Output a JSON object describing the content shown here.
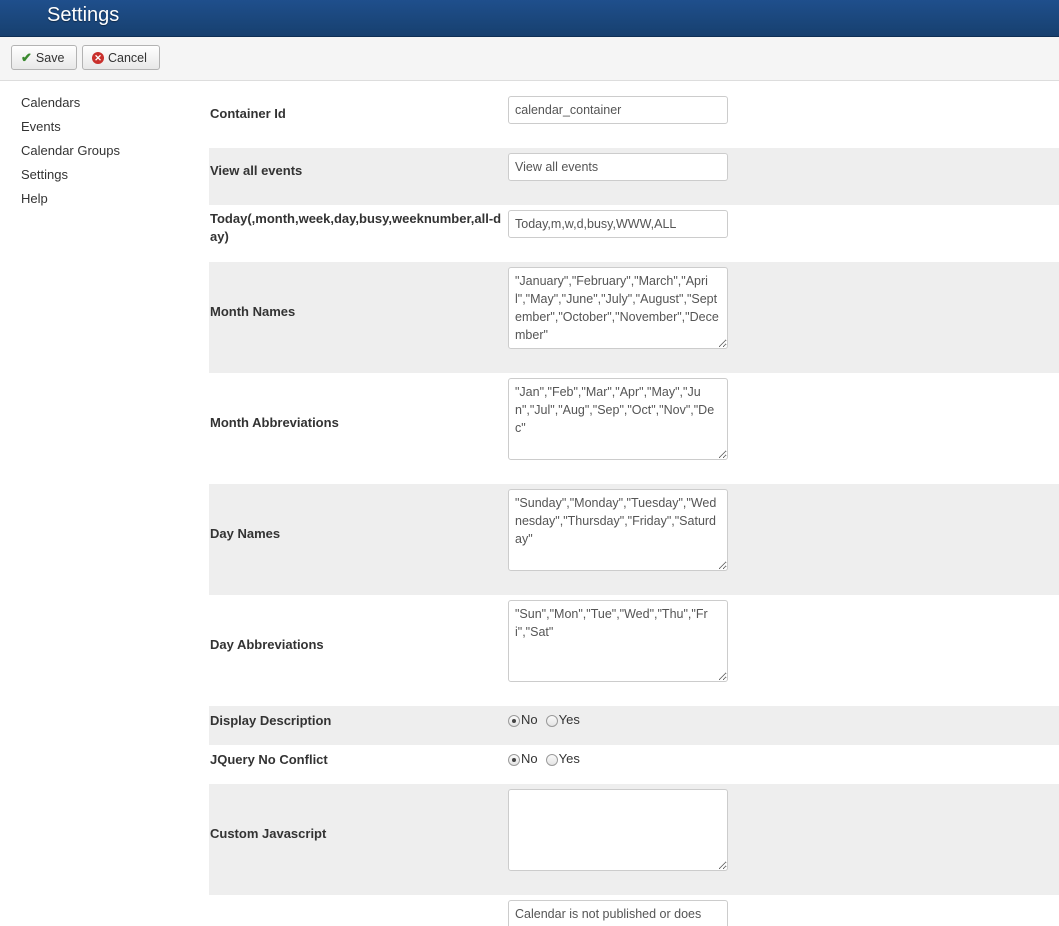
{
  "header": {
    "title": "Settings"
  },
  "toolbar": {
    "save_label": "Save",
    "cancel_label": "Cancel"
  },
  "sidebar": {
    "items": [
      {
        "label": "Calendars"
      },
      {
        "label": "Events"
      },
      {
        "label": "Calendar Groups"
      },
      {
        "label": "Settings"
      },
      {
        "label": "Help"
      }
    ]
  },
  "form": {
    "container_id": {
      "label": "Container Id",
      "value": "calendar_container"
    },
    "view_all_events": {
      "label": "View all events",
      "value": "View all events"
    },
    "today": {
      "label": "Today(,month,week,day,busy,weeknumber,all-day)",
      "value": "Today,m,w,d,busy,WWW,ALL"
    },
    "month_names": {
      "label": "Month Names",
      "value": "\"January\",\"February\",\"March\",\"April\",\"May\",\"June\",\"July\",\"August\",\"September\",\"October\",\"November\",\"December\""
    },
    "month_abbr": {
      "label": "Month Abbreviations",
      "value": "\"Jan\",\"Feb\",\"Mar\",\"Apr\",\"May\",\"Jun\",\"Jul\",\"Aug\",\"Sep\",\"Oct\",\"Nov\",\"Dec\""
    },
    "day_names": {
      "label": "Day Names",
      "value": "\"Sunday\",\"Monday\",\"Tuesday\",\"Wednesday\",\"Thursday\",\"Friday\",\"Saturday\""
    },
    "day_abbr": {
      "label": "Day Abbreviations",
      "value": "\"Sun\",\"Mon\",\"Tue\",\"Wed\",\"Thu\",\"Fri\",\"Sat\""
    },
    "display_description": {
      "label": "Display Description",
      "option_no": "No",
      "option_yes": "Yes",
      "selected": "No"
    },
    "jquery_no_conflict": {
      "label": "JQuery No Conflict",
      "option_no": "No",
      "option_yes": "Yes",
      "selected": "No"
    },
    "custom_javascript": {
      "label": "Custom Javascript",
      "value": ""
    },
    "not_published_message": {
      "value": "Calendar is not published or does"
    }
  },
  "icons": {
    "save": "check-icon",
    "cancel": "cancel-circle-icon"
  },
  "colors": {
    "header": "#1f4f8c",
    "row_shade": "#eeeeee",
    "save_check": "#3a8a2f",
    "cancel_x": "#c9302c"
  }
}
